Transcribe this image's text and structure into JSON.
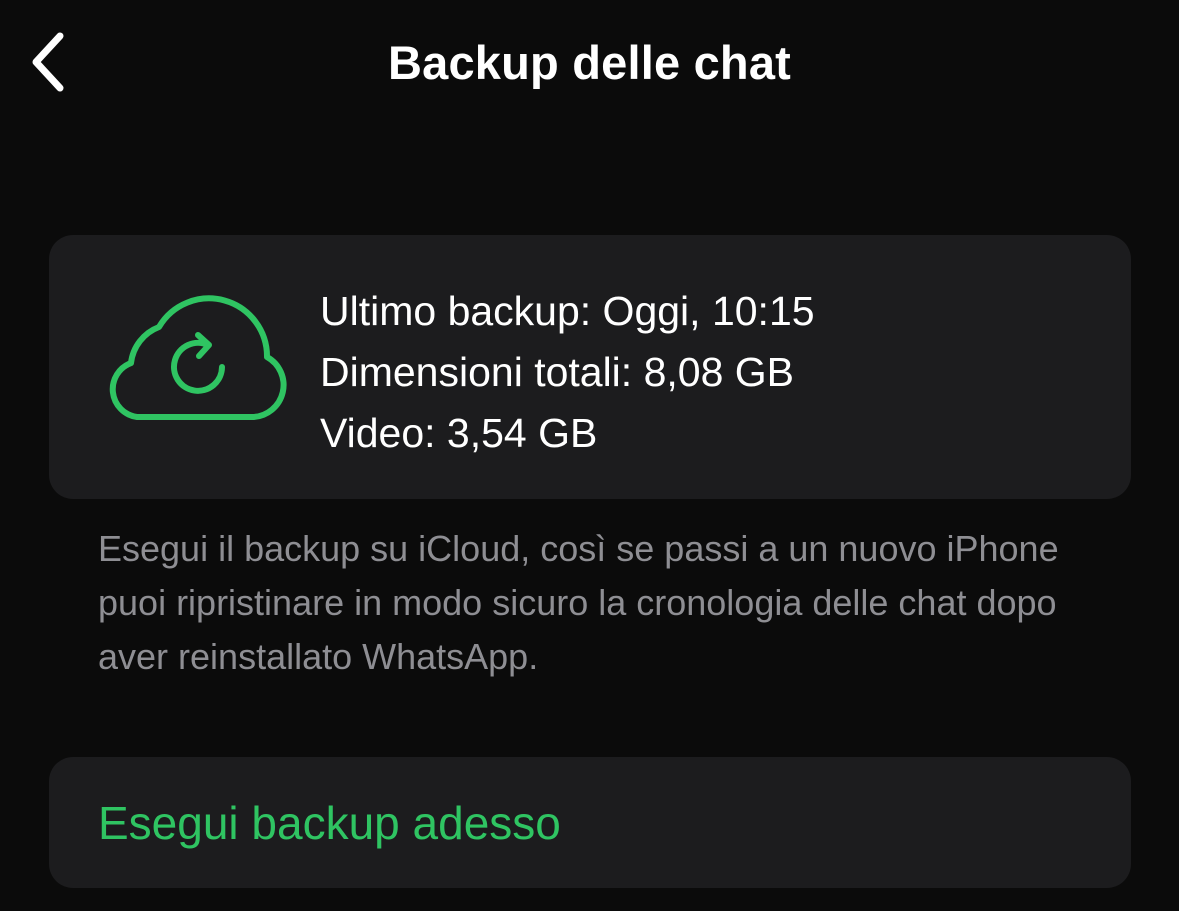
{
  "header": {
    "title": "Backup delle chat",
    "back_icon": "chevron-left-icon"
  },
  "backup_info": {
    "icon": "cloud-sync-icon",
    "last_backup": "Ultimo backup: Oggi, 10:15",
    "total_size": "Dimensioni totali: 8,08 GB",
    "video_size": "Video: 3,54 GB"
  },
  "description": "Esegui il backup su iCloud, così se passi a un nuovo iPhone puoi ripristinare in modo sicuro la cronologia delle chat dopo aver reinstallato WhatsApp.",
  "actions": {
    "backup_now_label": "Esegui backup adesso"
  },
  "colors": {
    "background": "#0b0b0b",
    "card": "#1c1c1e",
    "accent_green": "#2fc462",
    "secondary_text": "#8e8e93",
    "primary_text": "#ffffff"
  }
}
